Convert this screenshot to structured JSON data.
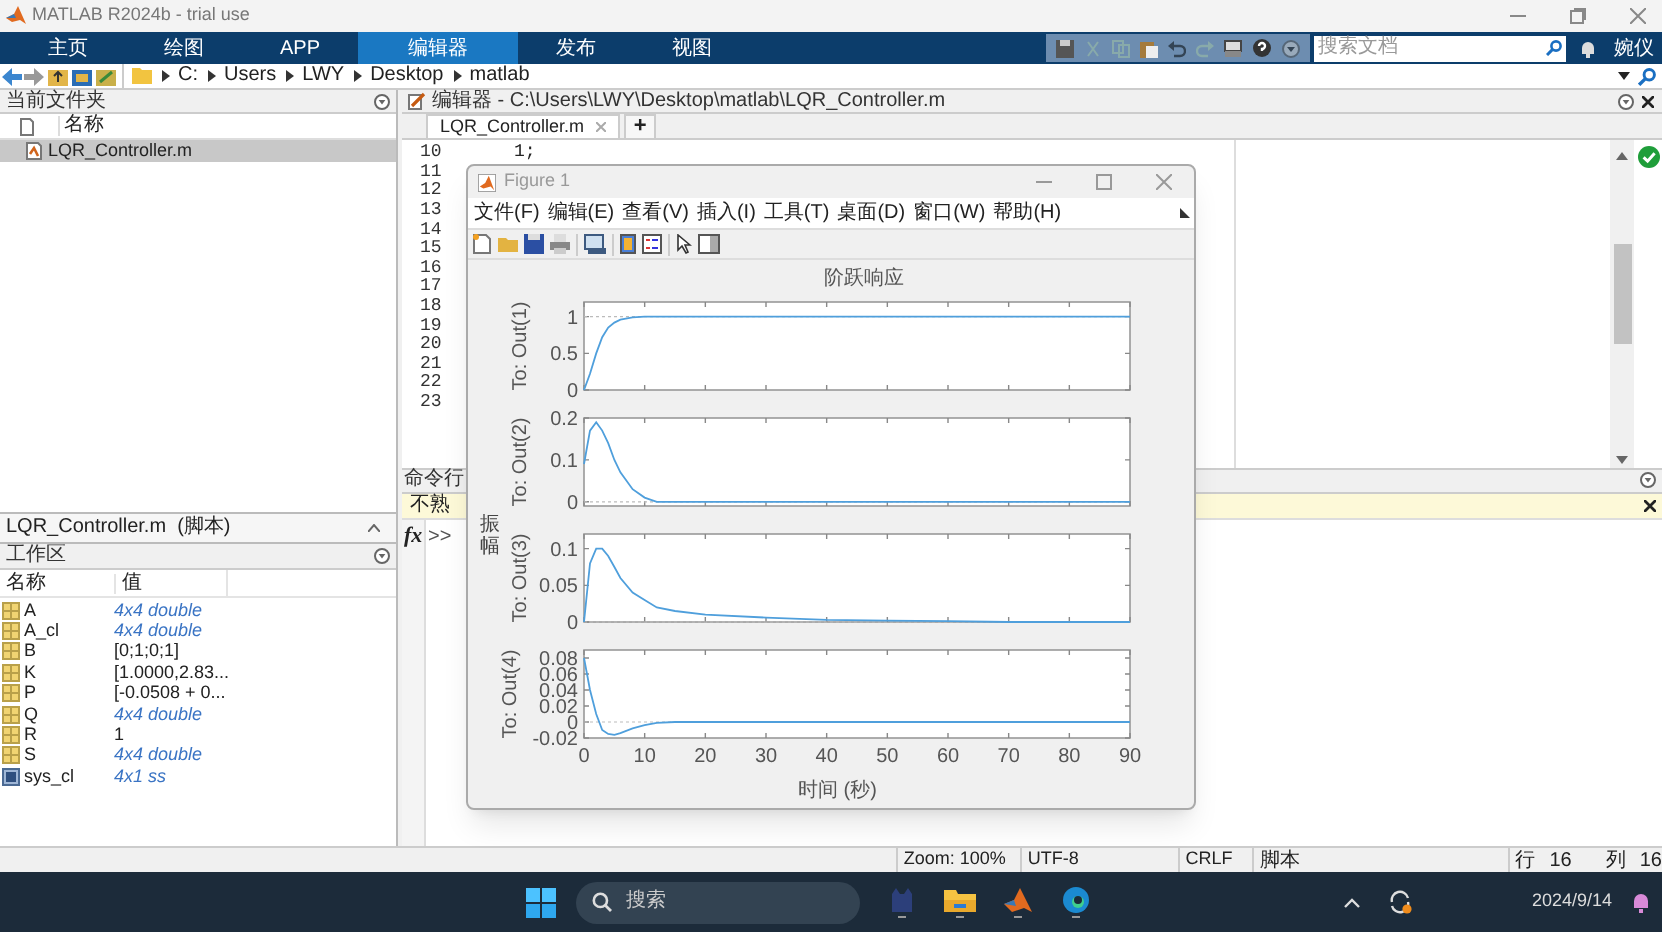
{
  "window": {
    "title": "MATLAB R2024b - trial use"
  },
  "ribbon_tabs": [
    {
      "label": "主页",
      "selected": false
    },
    {
      "label": "绘图",
      "selected": false
    },
    {
      "label": "APP",
      "selected": false
    },
    {
      "label": "编辑器",
      "selected": true
    },
    {
      "label": "发布",
      "selected": false
    },
    {
      "label": "视图",
      "selected": false
    }
  ],
  "doc_search": {
    "placeholder": "搜索文档"
  },
  "user": {
    "name": "婉仪"
  },
  "address_bar": {
    "path": [
      "C:",
      "Users",
      "LWY",
      "Desktop",
      "matlab"
    ]
  },
  "current_folder": {
    "title": "当前文件夹",
    "column": "名称",
    "files": [
      {
        "name": "LQR_Controller.m",
        "selected": true
      }
    ],
    "details": "LQR_Controller.m  (脚本)"
  },
  "workspace": {
    "title": "工作区",
    "columns": [
      "名称",
      "值"
    ],
    "variables": [
      {
        "name": "A",
        "value": "4x4 double",
        "kind": "matrix",
        "summary": true
      },
      {
        "name": "A_cl",
        "value": "4x4 double",
        "kind": "matrix",
        "summary": true
      },
      {
        "name": "B",
        "value": "[0;1;0;1]",
        "kind": "matrix",
        "summary": false
      },
      {
        "name": "K",
        "value": "[1.0000,2.83...",
        "kind": "matrix",
        "summary": false
      },
      {
        "name": "P",
        "value": "[-0.0508 + 0...",
        "kind": "matrix",
        "summary": false
      },
      {
        "name": "Q",
        "value": "4x4 double",
        "kind": "matrix",
        "summary": true
      },
      {
        "name": "R",
        "value": "1",
        "kind": "matrix",
        "summary": false
      },
      {
        "name": "S",
        "value": "4x4 double",
        "kind": "matrix",
        "summary": true
      },
      {
        "name": "sys_cl",
        "value": "4x1 ss",
        "kind": "object",
        "summary": true
      }
    ]
  },
  "editor": {
    "title": "编辑器 - C:\\Users\\LWY\\Desktop\\matlab\\LQR_Controller.m",
    "tabs": [
      {
        "label": "LQR_Controller.m",
        "selected": true
      }
    ],
    "add_tab": "+",
    "lines": [
      {
        "number": "10",
        "code": "1;"
      },
      {
        "number": "11"
      },
      {
        "number": "12"
      },
      {
        "number": "13"
      },
      {
        "number": "14"
      },
      {
        "number": "15"
      },
      {
        "number": "16"
      },
      {
        "number": "17"
      },
      {
        "number": "18"
      },
      {
        "number": "19"
      },
      {
        "number": "20"
      },
      {
        "number": "21"
      },
      {
        "number": "22"
      },
      {
        "number": "23"
      }
    ]
  },
  "command_window": {
    "title": "命令行",
    "notice": "不熟",
    "function_button": "fx",
    "prompt": ">>"
  },
  "figure": {
    "title": "Figure 1",
    "menu": [
      "文件(F)",
      "编辑(E)",
      "查看(V)",
      "插入(I)",
      "工具(T)",
      "桌面(D)",
      "窗口(W)",
      "帮助(H)"
    ],
    "plot": {
      "title": "阶跃响应",
      "xlabel": "时间 (秒)",
      "ylabel": "振幅",
      "subplots": [
        {
          "chart_data": {
            "type": "line",
            "x": [
              0,
              1,
              2,
              3,
              4,
              5,
              6,
              8,
              10,
              12,
              15,
              20,
              30,
              40,
              50,
              60,
              70,
              80,
              90
            ],
            "series": [
              {
                "name": "To: Out(1)",
                "color": "#4f9fdc",
                "values": [
                  0,
                  0.22,
                  0.5,
                  0.72,
                  0.85,
                  0.92,
                  0.96,
                  0.99,
                  1,
                  1,
                  1,
                  1,
                  1,
                  1,
                  1,
                  1,
                  1,
                  1,
                  1
                ]
              }
            ],
            "xlim": [
              0,
              90
            ],
            "ylim": [
              0,
              1.2
            ],
            "yticks": [
              0,
              0.5,
              1
            ]
          }
        },
        {
          "chart_data": {
            "type": "line",
            "x": [
              0,
              1,
              2,
              3,
              4,
              5,
              6,
              8,
              10,
              12,
              15,
              20,
              30,
              40,
              50,
              60,
              70,
              80,
              90
            ],
            "series": [
              {
                "name": "To: Out(2)",
                "color": "#4f9fdc",
                "values": [
                  0.09,
                  0.17,
                  0.19,
                  0.17,
                  0.14,
                  0.1,
                  0.07,
                  0.03,
                  0.01,
                  0,
                  0,
                  0,
                  0,
                  0,
                  0,
                  0,
                  0,
                  0,
                  0
                ]
              }
            ],
            "xlim": [
              0,
              90
            ],
            "ylim": [
              -0.01,
              0.2
            ],
            "yticks": [
              0,
              0.1,
              0.2
            ]
          }
        },
        {
          "chart_data": {
            "type": "line",
            "x": [
              0,
              1,
              2,
              3,
              4,
              5,
              6,
              8,
              10,
              12,
              15,
              20,
              30,
              40,
              50,
              60,
              70,
              80,
              90
            ],
            "series": [
              {
                "name": "To: Out(3)",
                "color": "#4f9fdc",
                "values": [
                  0,
                  0.08,
                  0.1,
                  0.1,
                  0.09,
                  0.075,
                  0.06,
                  0.04,
                  0.03,
                  0.02,
                  0.015,
                  0.01,
                  0.006,
                  0.003,
                  0.002,
                  0.001,
                  0,
                  0,
                  0
                ]
              }
            ],
            "xlim": [
              0,
              90
            ],
            "ylim": [
              0,
              0.12
            ],
            "yticks": [
              0,
              0.05,
              0.1
            ]
          }
        },
        {
          "chart_data": {
            "type": "line",
            "x": [
              0,
              1,
              2,
              3,
              4,
              5,
              6,
              8,
              10,
              12,
              15,
              20,
              30,
              40,
              50,
              60,
              70,
              80,
              90
            ],
            "series": [
              {
                "name": "To: Out(4)",
                "color": "#4f9fdc",
                "values": [
                  0.08,
                  0.04,
                  0.01,
                  -0.01,
                  -0.015,
                  -0.016,
                  -0.014,
                  -0.008,
                  -0.004,
                  -0.001,
                  0,
                  0,
                  0,
                  0,
                  0,
                  0,
                  0,
                  0,
                  0
                ]
              }
            ],
            "xlim": [
              0,
              90
            ],
            "ylim": [
              -0.02,
              0.09
            ],
            "xticks": [
              0,
              10,
              20,
              30,
              40,
              50,
              60,
              70,
              80,
              90
            ],
            "yticks": [
              -0.02,
              0,
              0.02,
              0.04,
              0.06,
              0.08
            ]
          }
        }
      ]
    }
  },
  "status_bar": {
    "zoom": "Zoom: 100%",
    "encoding": "UTF-8",
    "line_ending": "CRLF",
    "file_type": "脚本",
    "row_label": "行",
    "row": "16",
    "col_label": "列",
    "col": "16"
  },
  "taskbar": {
    "search_placeholder": "搜索",
    "date": "2024/9/14"
  }
}
